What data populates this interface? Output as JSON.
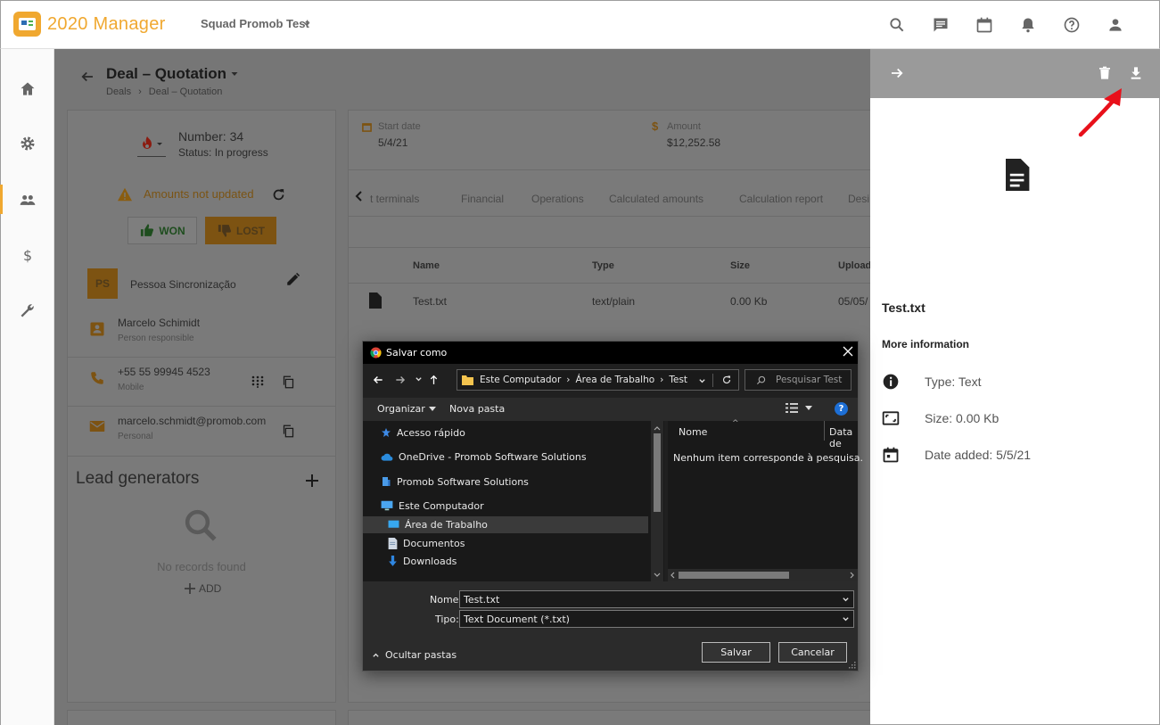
{
  "app": {
    "name": "2020 Manager",
    "workspace": "Squad Promob Test"
  },
  "topbar_icons": [
    "search-icon",
    "chat-icon",
    "calendar-icon",
    "bell-icon",
    "help-icon",
    "account-icon"
  ],
  "sidebar": {
    "items": [
      "home-icon",
      "gear-icon",
      "people-icon",
      "dollar-icon",
      "wrench-icon"
    ],
    "active_index": 2
  },
  "page": {
    "title": "Deal – Quotation",
    "breadcrumb": [
      "Deals",
      "Deal – Quotation"
    ]
  },
  "deal": {
    "number": "Number: 34",
    "status": "Status: In progress",
    "warning": "Amounts not updated",
    "won_label": "WON",
    "lost_label": "LOST",
    "owner_initials": "PS",
    "owner_name": "Pessoa Sincronização",
    "responsible_name": "Marcelo Schimidt",
    "responsible_role": "Person responsible",
    "phone": "+55 55 99945 4523",
    "phone_type": "Mobile",
    "email": "marcelo.schmidt@promob.com",
    "email_type": "Personal"
  },
  "lead_generators": {
    "title": "Lead generators",
    "empty": "No records found",
    "add_label": "ADD"
  },
  "summary": {
    "start_label": "Start date",
    "start_value": "5/4/21",
    "amount_label": "Amount",
    "amount_value": "$12,252.58"
  },
  "tabs": [
    "t terminals",
    "Financial",
    "Operations",
    "Calculated amounts",
    "Calculation report",
    "Desi"
  ],
  "files_table": {
    "headers": [
      "Name",
      "Type",
      "Size",
      "Upload"
    ],
    "rows": [
      {
        "name": "Test.txt",
        "type": "text/plain",
        "size": "0.00 Kb",
        "uploaded": "05/05/"
      }
    ]
  },
  "right_panel": {
    "file_name": "Test.txt",
    "more_info": "More information",
    "type": "Type: Text",
    "size": "Size: 0.00 Kb",
    "date_added": "Date added: 5/5/21"
  },
  "dialog": {
    "title": "Salvar como",
    "path": [
      "Este Computador",
      "Área de Trabalho",
      "Test"
    ],
    "search_placeholder": "Pesquisar Test",
    "organize": "Organizar",
    "new_folder": "Nova pasta",
    "tree": [
      "Acesso rápido",
      "OneDrive - Promob Software Solutions",
      "Promob Software Solutions",
      "Este Computador",
      "Área de Trabalho",
      "Documentos",
      "Downloads"
    ],
    "col_name": "Nome",
    "col_date": "Data de",
    "empty_msg": "Nenhum item corresponde à pesquisa.",
    "name_label": "Nome:",
    "name_value": "Test.txt",
    "type_label": "Tipo:",
    "type_value": "Text Document (*.txt)",
    "hide_folders": "Ocultar pastas",
    "save": "Salvar",
    "cancel": "Cancelar"
  },
  "colors": {
    "accent": "#f0a830",
    "arrow": "#e8101a"
  }
}
